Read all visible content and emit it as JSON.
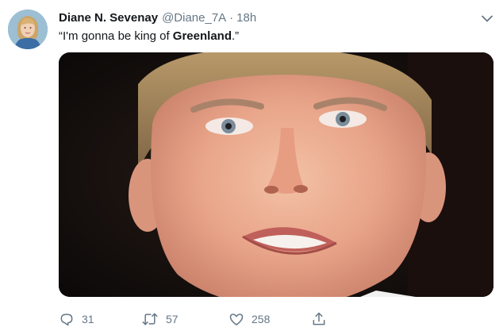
{
  "tweet": {
    "display_name": "Diane N. Sevenay",
    "handle": "@Diane_7A",
    "separator": "·",
    "timestamp": "18h",
    "text_before": "“I'm gonna be king of ",
    "text_bold": "Greenland",
    "text_after": ".”"
  },
  "actions": {
    "reply_count": "31",
    "retweet_count": "57",
    "like_count": "258"
  },
  "icons": {
    "caret": "chevron-down-icon",
    "reply": "reply-icon",
    "retweet": "retweet-icon",
    "like": "heart-icon",
    "share": "share-icon"
  },
  "colors": {
    "text": "#14171a",
    "secondary": "#657786",
    "background": "#ffffff"
  }
}
